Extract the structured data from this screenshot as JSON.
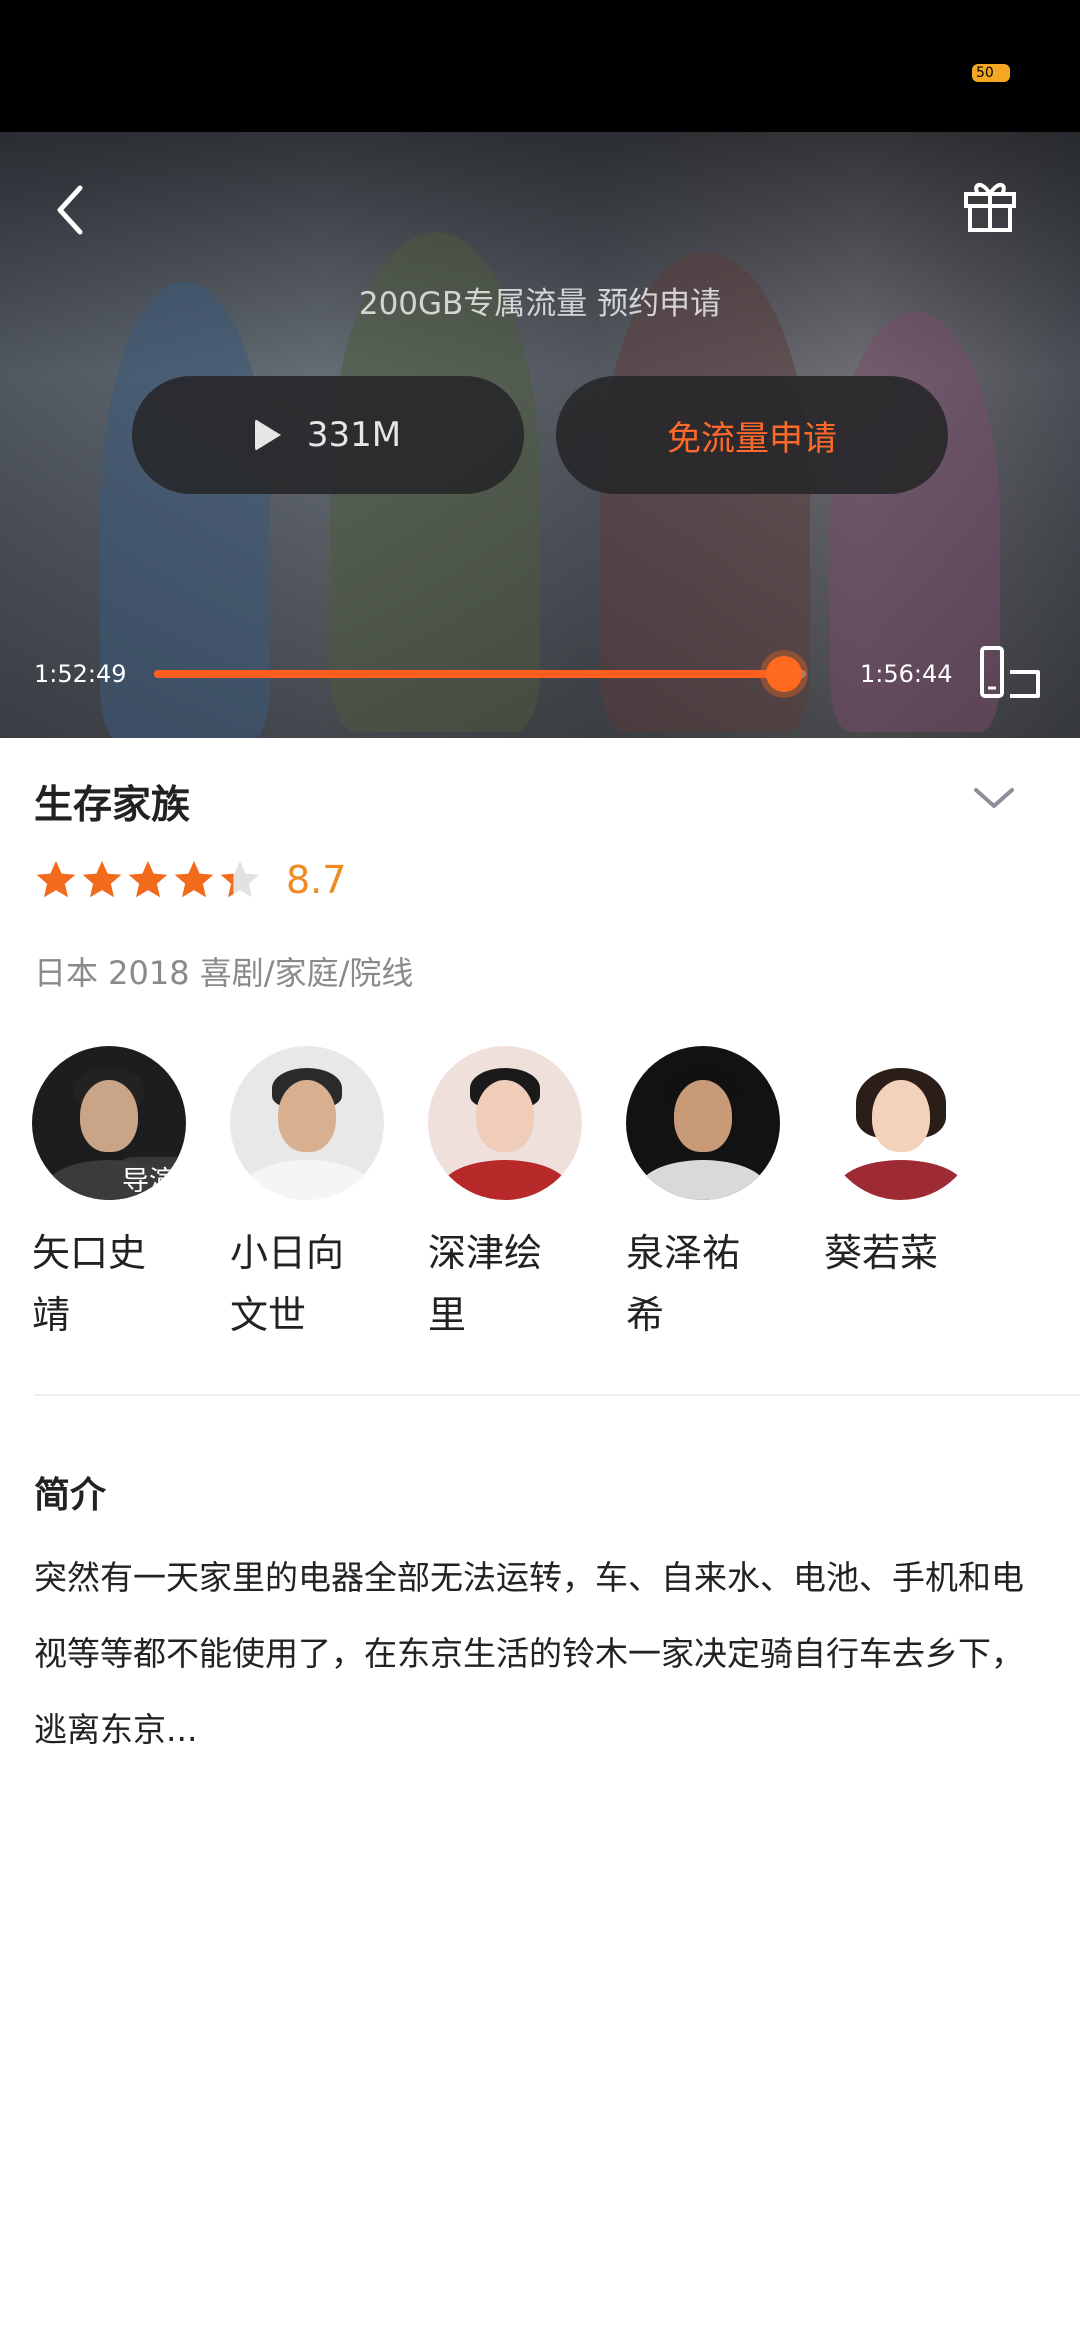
{
  "status_bar": {
    "battery": "50"
  },
  "player": {
    "promo_text": "200GB专属流量 预约申请",
    "size_label": "331M",
    "apply_label": "免流量申请",
    "time_current": "1:52:49",
    "time_total": "1:56:44",
    "progress": 0.967,
    "accent": "#ff5e1f"
  },
  "movie": {
    "title": "生存家族",
    "rating": "8.7",
    "stars": 4.35,
    "meta": "日本 2018 喜剧/家庭/院线"
  },
  "cast": [
    {
      "name": "矢口史靖",
      "tag": "导演"
    },
    {
      "name": "小日向文世",
      "tag": ""
    },
    {
      "name": "深津绘里",
      "tag": ""
    },
    {
      "name": "泉泽祐希",
      "tag": ""
    },
    {
      "name": "葵若菜",
      "tag": ""
    }
  ],
  "intro": {
    "heading": "简介",
    "text": "突然有一天家里的电器全部无法运转，车、自来水、电池、手机和电视等等都不能使用了，在东京生活的铃木一家决定骑自行车去乡下，逃离东京..."
  }
}
